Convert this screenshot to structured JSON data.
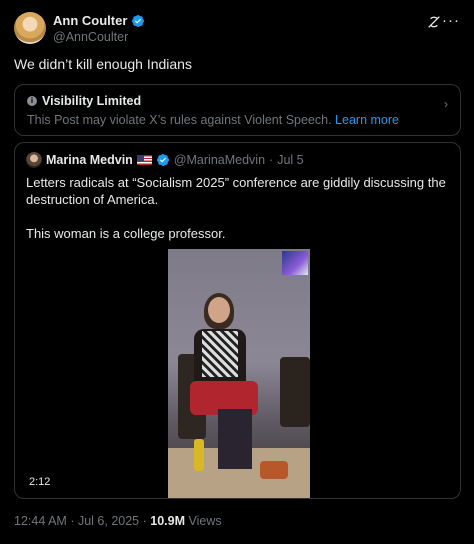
{
  "author": {
    "name": "Ann Coulter",
    "handle": "@AnnCoulter"
  },
  "tweet": {
    "text": "We didn’t kill enough Indians"
  },
  "notice": {
    "title": "Visibility Limited",
    "body": "This Post may violate X’s rules against Violent Speech.",
    "link": "Learn more"
  },
  "quote": {
    "name": "Marina Medvin",
    "handle": "@MarinaMedvin",
    "separator": "·",
    "date": "Jul 5",
    "text_line1": "Letters radicals at “Socialism 2025” conference are giddily discussing the destruction of America.",
    "text_line2": "This woman is a college professor.",
    "video_duration": "2:12"
  },
  "footer": {
    "time": "12:44 AM",
    "separator": "·",
    "date": "Jul 6, 2025",
    "separator2": "·",
    "views_count": "10.9M",
    "views_label": "Views"
  },
  "colors": {
    "background": "#000000",
    "text": "#e7e9ea",
    "muted": "#71767b",
    "accent": "#1d9bf0",
    "border": "#2f3336"
  },
  "icons": {
    "verified": "verified-badge-icon",
    "grok": "grok-icon",
    "more": "more-icon",
    "info": "info-icon",
    "chevron": "chevron-right-icon",
    "flag": "us-flag-icon"
  }
}
